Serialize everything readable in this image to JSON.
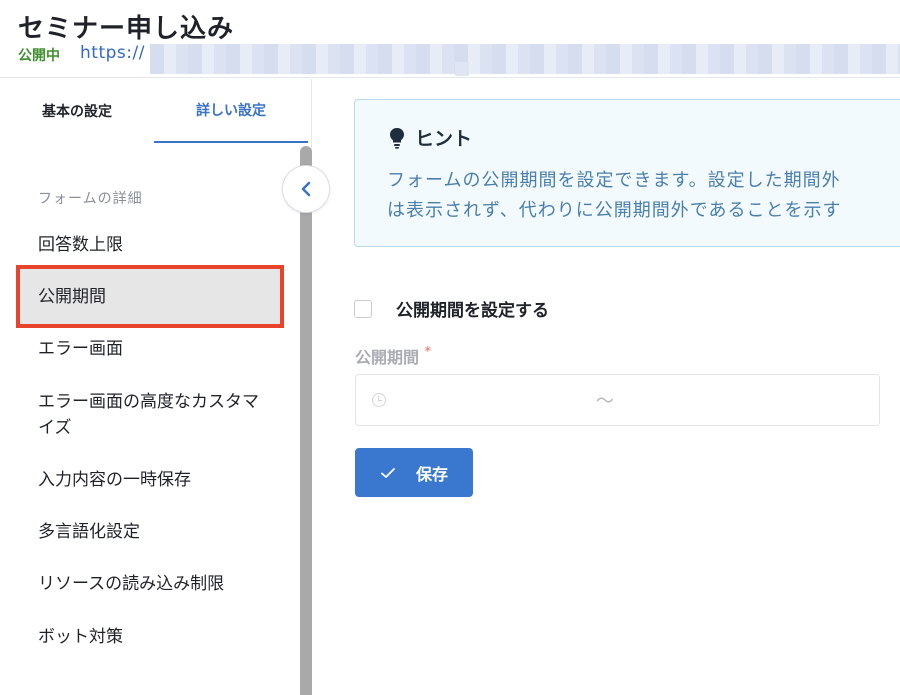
{
  "header": {
    "title": "セミナー申し込み",
    "status": "公開中",
    "url": "https://"
  },
  "sidebar": {
    "tabs": [
      {
        "label": "基本の設定",
        "active": false
      },
      {
        "label": "詳しい設定",
        "active": true
      }
    ],
    "section_label": "フォームの詳細",
    "items": [
      {
        "label": "回答数上限"
      },
      {
        "label": "公開期間",
        "active": true
      },
      {
        "label": "エラー画面"
      },
      {
        "label": "エラー画面の高度なカスタマイズ"
      },
      {
        "label": "入力内容の一時保存"
      },
      {
        "label": "多言語化設定"
      },
      {
        "label": "リソースの読み込み制限"
      },
      {
        "label": "ボット対策"
      }
    ],
    "collapse_icon": "chevron-left-icon"
  },
  "hint": {
    "title": "ヒント",
    "line1": "フォームの公開期間を設定できます。設定した期間外",
    "line2": "は表示されず、代わりに公開期間外であることを示す"
  },
  "form": {
    "checkbox_label": "公開期間を設定する",
    "checkbox_checked": false,
    "field_label": "公開期間",
    "required_mark": "*",
    "range_separator": "〜",
    "save_label": "保存"
  },
  "colors": {
    "accent": "#3a78d0",
    "status_green": "#3f8f2f",
    "highlight_border": "#e8442b"
  }
}
